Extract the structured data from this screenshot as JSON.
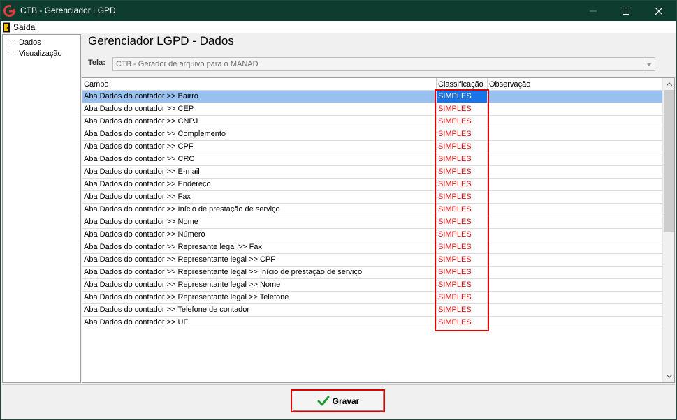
{
  "window": {
    "title": "CTB - Gerenciador LGPD",
    "controls": [
      "minimize-icon",
      "maximize-icon",
      "close-icon"
    ]
  },
  "menu": {
    "exit_label": "Saída"
  },
  "tree": {
    "items": [
      {
        "label": "Dados"
      },
      {
        "label": "Visualização"
      }
    ]
  },
  "main": {
    "title": "Gerenciador LGPD - Dados",
    "screen_label": "Tela:",
    "screen_value": "CTB - Gerador de arquivo para o MANAD"
  },
  "grid": {
    "columns": [
      "Campo",
      "Classificação",
      "Observação"
    ],
    "rows": [
      {
        "campo": "Aba Dados do contador >> Bairro",
        "classificacao": "SIMPLES",
        "observacao": "",
        "selected": true
      },
      {
        "campo": "Aba Dados do contador >> CEP",
        "classificacao": "SIMPLES",
        "observacao": ""
      },
      {
        "campo": "Aba Dados do contador >> CNPJ",
        "classificacao": "SIMPLES",
        "observacao": ""
      },
      {
        "campo": "Aba Dados do contador >> Complemento",
        "classificacao": "SIMPLES",
        "observacao": ""
      },
      {
        "campo": "Aba Dados do contador >> CPF",
        "classificacao": "SIMPLES",
        "observacao": ""
      },
      {
        "campo": "Aba Dados do contador >> CRC",
        "classificacao": "SIMPLES",
        "observacao": ""
      },
      {
        "campo": "Aba Dados do contador >> E-mail",
        "classificacao": "SIMPLES",
        "observacao": ""
      },
      {
        "campo": "Aba Dados do contador >> Endereço",
        "classificacao": "SIMPLES",
        "observacao": ""
      },
      {
        "campo": "Aba Dados do contador >> Fax",
        "classificacao": "SIMPLES",
        "observacao": ""
      },
      {
        "campo": "Aba Dados do contador >> Início de prestação de serviço",
        "classificacao": "SIMPLES",
        "observacao": ""
      },
      {
        "campo": "Aba Dados do contador >> Nome",
        "classificacao": "SIMPLES",
        "observacao": ""
      },
      {
        "campo": "Aba Dados do contador >> Número",
        "classificacao": "SIMPLES",
        "observacao": ""
      },
      {
        "campo": "Aba Dados do contador >> Represante legal >> Fax",
        "classificacao": "SIMPLES",
        "observacao": ""
      },
      {
        "campo": "Aba Dados do contador >> Representante legal >> CPF",
        "classificacao": "SIMPLES",
        "observacao": ""
      },
      {
        "campo": "Aba Dados do contador >> Representante legal >> Início de prestação de serviço",
        "classificacao": "SIMPLES",
        "observacao": ""
      },
      {
        "campo": "Aba Dados do contador >> Representante legal >> Nome",
        "classificacao": "SIMPLES",
        "observacao": ""
      },
      {
        "campo": "Aba Dados do contador >> Representante legal >> Telefone",
        "classificacao": "SIMPLES",
        "observacao": ""
      },
      {
        "campo": "Aba Dados do contador >> Telefone de contador",
        "classificacao": "SIMPLES",
        "observacao": ""
      },
      {
        "campo": "Aba Dados do contador >> UF",
        "classificacao": "SIMPLES",
        "observacao": ""
      }
    ]
  },
  "footer": {
    "save_label_first": "G",
    "save_label_rest": "ravar"
  },
  "colors": {
    "titlebar": "#0e3d30",
    "highlight": "#e00000",
    "classification_text": "#e01010",
    "selection": "#1874e8"
  }
}
